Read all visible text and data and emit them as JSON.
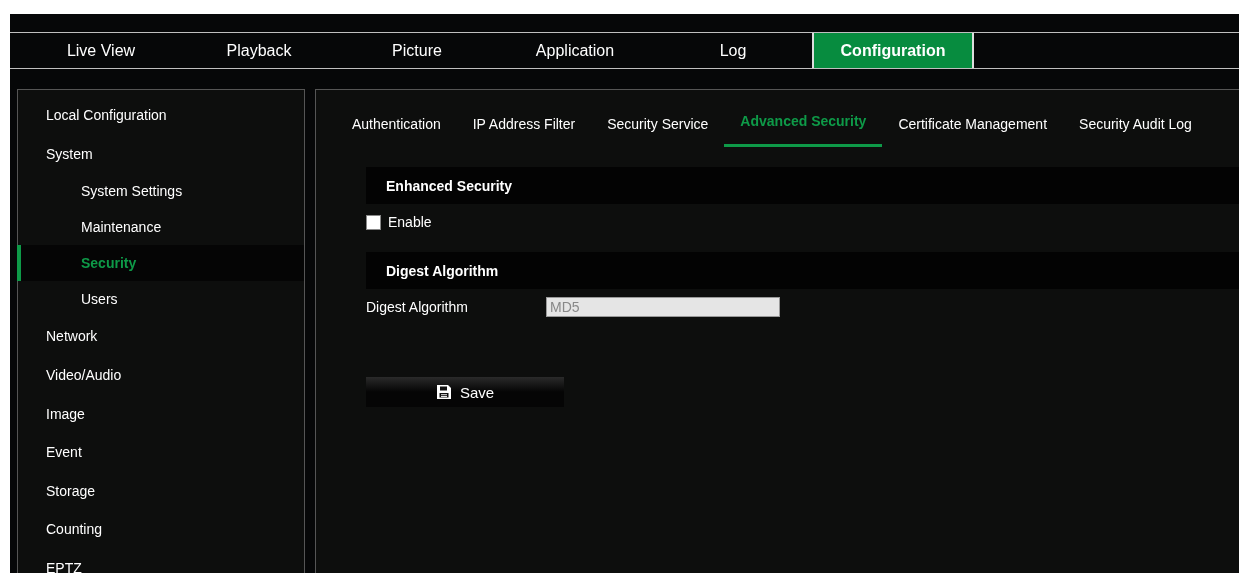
{
  "nav_tabs": [
    {
      "label": "Live View",
      "selected": false
    },
    {
      "label": "Playback",
      "selected": false
    },
    {
      "label": "Picture",
      "selected": false
    },
    {
      "label": "Application",
      "selected": false
    },
    {
      "label": "Log",
      "selected": false
    },
    {
      "label": "Configuration",
      "selected": true
    }
  ],
  "sidebar": {
    "items": [
      {
        "label": "Local Configuration",
        "selected": false
      },
      {
        "label": "System",
        "selected": false,
        "children": [
          {
            "label": "System Settings",
            "selected": false
          },
          {
            "label": "Maintenance",
            "selected": false
          },
          {
            "label": "Security",
            "selected": true
          },
          {
            "label": "Users",
            "selected": false
          }
        ]
      },
      {
        "label": "Network",
        "selected": false
      },
      {
        "label": "Video/Audio",
        "selected": false
      },
      {
        "label": "Image",
        "selected": false
      },
      {
        "label": "Event",
        "selected": false
      },
      {
        "label": "Storage",
        "selected": false
      },
      {
        "label": "Counting",
        "selected": false
      },
      {
        "label": "EPTZ",
        "selected": false
      }
    ]
  },
  "sub_tabs": [
    {
      "label": "Authentication",
      "selected": false
    },
    {
      "label": "IP Address Filter",
      "selected": false
    },
    {
      "label": "Security Service",
      "selected": false
    },
    {
      "label": "Advanced Security",
      "selected": true
    },
    {
      "label": "Certificate Management",
      "selected": false
    },
    {
      "label": "Security Audit Log",
      "selected": false
    }
  ],
  "sections": [
    {
      "title": "Enhanced Security",
      "fields": [
        {
          "kind": "checkbox",
          "label": "Enable",
          "checked": false
        }
      ]
    },
    {
      "title": "Digest Algorithm",
      "fields": [
        {
          "kind": "text",
          "label": "Digest Algorithm",
          "value": "MD5",
          "disabled": true
        }
      ]
    }
  ],
  "save_button": {
    "label": "Save"
  }
}
